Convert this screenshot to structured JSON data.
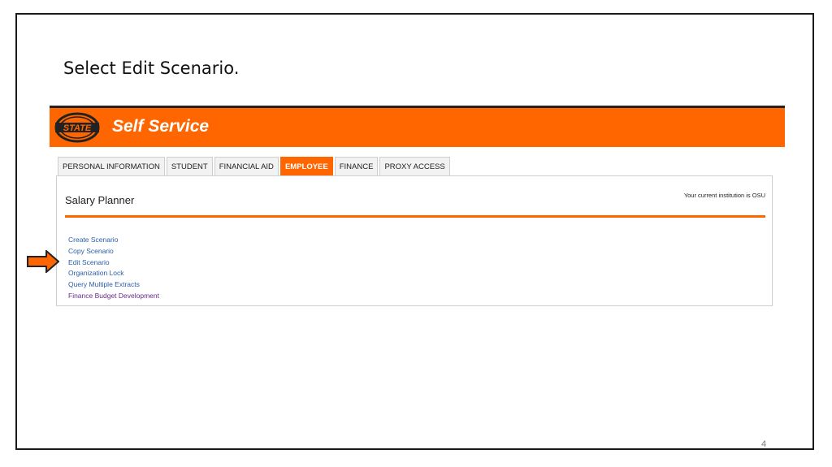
{
  "slide": {
    "title": "Select Edit Scenario.",
    "page_number": "4"
  },
  "banner": {
    "title": "Self Service",
    "logo_text": "STATE",
    "color": "#ff6600"
  },
  "tabs": [
    {
      "label": "PERSONAL INFORMATION",
      "active": false
    },
    {
      "label": "STUDENT",
      "active": false
    },
    {
      "label": "FINANCIAL AID",
      "active": false
    },
    {
      "label": "EMPLOYEE",
      "active": true
    },
    {
      "label": "FINANCE",
      "active": false
    },
    {
      "label": "PROXY ACCESS",
      "active": false
    }
  ],
  "panel": {
    "title": "Salary Planner",
    "institution": "Your current institution is OSU",
    "links": [
      {
        "label": "Create Scenario"
      },
      {
        "label": "Copy Scenario"
      },
      {
        "label": "Edit Scenario"
      },
      {
        "label": "Organization Lock"
      },
      {
        "label": "Query Multiple Extracts"
      },
      {
        "label": "Finance Budget Development"
      }
    ]
  },
  "arrow": {
    "icon": "right-arrow-icon",
    "color": "#ff6600"
  }
}
